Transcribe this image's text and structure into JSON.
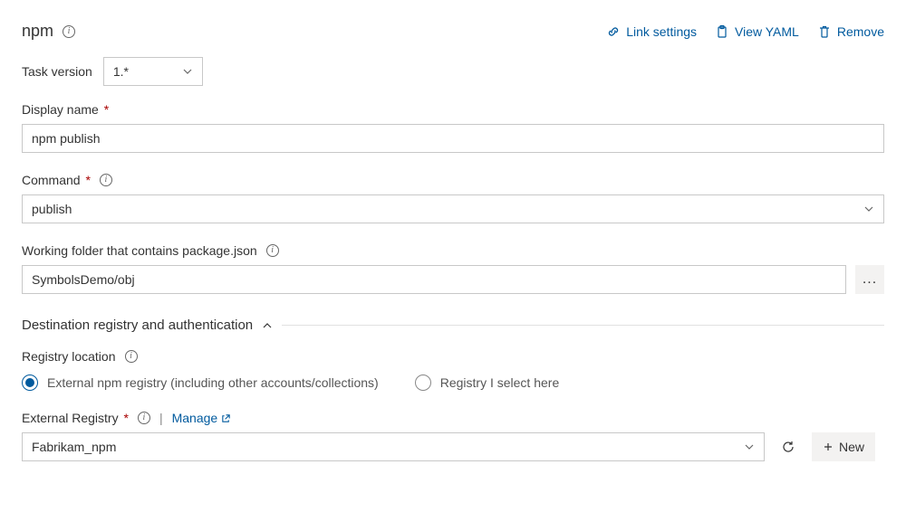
{
  "header": {
    "title": "npm",
    "actions": {
      "link_settings": "Link settings",
      "view_yaml": "View YAML",
      "remove": "Remove"
    }
  },
  "task_version": {
    "label": "Task version",
    "value": "1.*"
  },
  "display_name": {
    "label": "Display name",
    "value": "npm publish"
  },
  "command": {
    "label": "Command",
    "value": "publish"
  },
  "working_folder": {
    "label": "Working folder that contains package.json",
    "value": "SymbolsDemo/obj"
  },
  "section": {
    "title": "Destination registry and authentication"
  },
  "registry_location": {
    "label": "Registry location",
    "options": {
      "external": "External npm registry (including other accounts/collections)",
      "select_here": "Registry I select here"
    },
    "selected": "external"
  },
  "external_registry": {
    "label": "External Registry",
    "manage": "Manage",
    "value": "Fabrikam_npm",
    "new_button": "New"
  }
}
